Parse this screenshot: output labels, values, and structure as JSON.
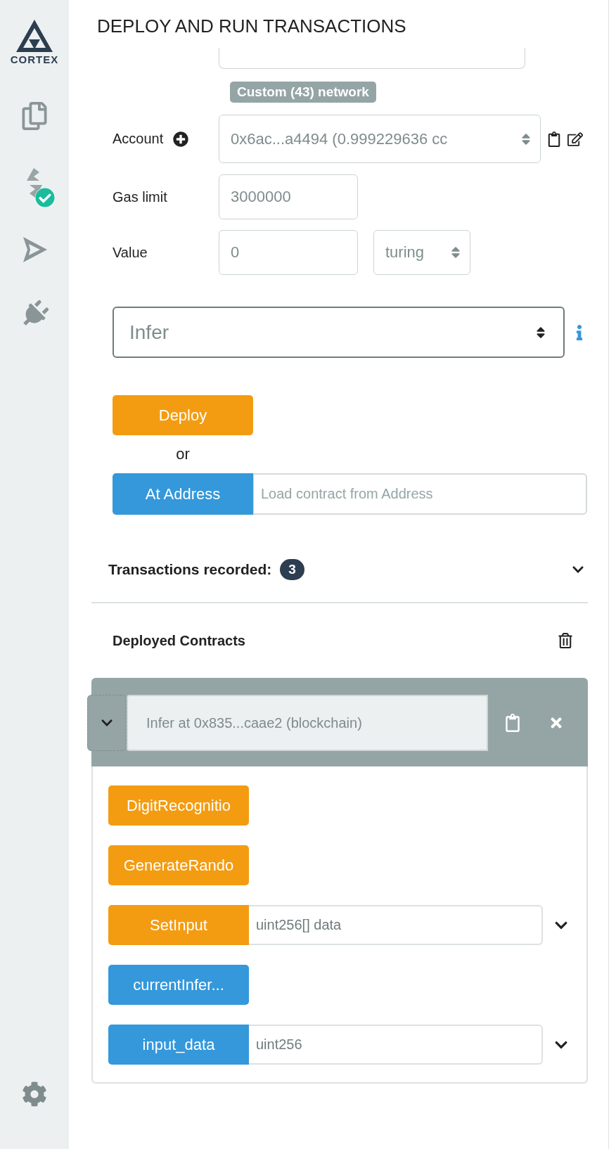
{
  "sidebar": {
    "logo_text": "CORTEX",
    "compiler_ok": true
  },
  "panel": {
    "title": "DEPLOY AND RUN TRANSACTIONS"
  },
  "network_badge": "Custom (43) network",
  "account": {
    "label": "Account",
    "value": "0x6ac...a4494 (0.999229636 cc"
  },
  "gas_limit": {
    "label": "Gas limit",
    "value": "3000000"
  },
  "value": {
    "label": "Value",
    "value": "0",
    "unit": "turing"
  },
  "contract_select": {
    "value": "Infer"
  },
  "deploy_button": "Deploy",
  "or_text": "or",
  "at_address": {
    "button": "At Address",
    "placeholder": "Load contract from Address"
  },
  "transactions": {
    "label": "Transactions recorded:",
    "count": "3",
    "expanded": false
  },
  "deployed": {
    "title": "Deployed Contracts",
    "contracts": [
      {
        "name": "Infer at 0x835...caae2 (blockchain)",
        "expanded": true,
        "functions": [
          {
            "label": "DigitRecognitio",
            "kind": "transact"
          },
          {
            "label": "GenerateRando",
            "kind": "transact"
          },
          {
            "label": "SetInput",
            "kind": "transact",
            "placeholder": "uint256[] data"
          },
          {
            "label": "currentInfer...",
            "kind": "call"
          },
          {
            "label": "input_data",
            "kind": "call",
            "placeholder": "uint256"
          }
        ]
      }
    ]
  }
}
